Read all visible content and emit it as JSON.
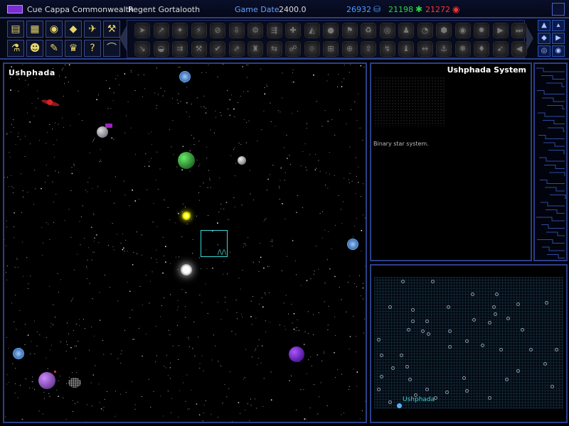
{
  "topbar": {
    "empire_name": "Cue Cappa Commonwealth",
    "leader": "Regent Gortalooth",
    "date_label": "Game Date",
    "date_value": "2400.0",
    "credits": "26932",
    "research": "21198",
    "intel": "21272",
    "colors": {
      "credits": "#4d9bff",
      "research": "#27d93f",
      "intel": "#ff3333",
      "label": "#6aa0ff"
    }
  },
  "map": {
    "title": "Ushphada"
  },
  "info": {
    "title": "Ushphada System",
    "description": "Binary star system."
  },
  "galaxy": {
    "home_label": "Ushphada"
  },
  "left_tools": [
    {
      "name": "empire-icon",
      "glyph": "▤"
    },
    {
      "name": "planets-icon",
      "glyph": "▦"
    },
    {
      "name": "colonies-icon",
      "glyph": "◉"
    },
    {
      "name": "ships-icon",
      "glyph": "◆"
    },
    {
      "name": "fleets-icon",
      "glyph": "✈"
    },
    {
      "name": "designs-icon",
      "glyph": "⚒"
    },
    {
      "name": "research-icon",
      "glyph": "⚗"
    },
    {
      "name": "races-icon",
      "glyph": "☻"
    },
    {
      "name": "log-icon",
      "glyph": "✎"
    },
    {
      "name": "leader-icon",
      "glyph": "♛"
    },
    {
      "name": "help-icon",
      "glyph": "?"
    },
    {
      "name": "misc-icon",
      "glyph": "⌒"
    }
  ],
  "cmd_icons": [
    "➤",
    "↗",
    "✦",
    "⚡",
    "⊘",
    "⇩",
    "⚙",
    "⇶",
    "✚",
    "◭",
    "●",
    "⚑",
    "♻",
    "◎",
    "♟",
    "◔",
    "⬢",
    "◉",
    "✹",
    "▶",
    "⏭",
    "↘",
    "◒",
    "⇉",
    "⚒",
    "✔",
    "⇗",
    "♜",
    "⇆",
    "☍",
    "⌾",
    "⊞",
    "⊕",
    "⇧",
    "↯",
    "♝",
    "↭",
    "⚓",
    "❋",
    "♦",
    "➹",
    "◀"
  ],
  "right_tools": [
    "▲",
    "▴",
    "◆",
    "▶",
    "◎",
    "◉"
  ]
}
